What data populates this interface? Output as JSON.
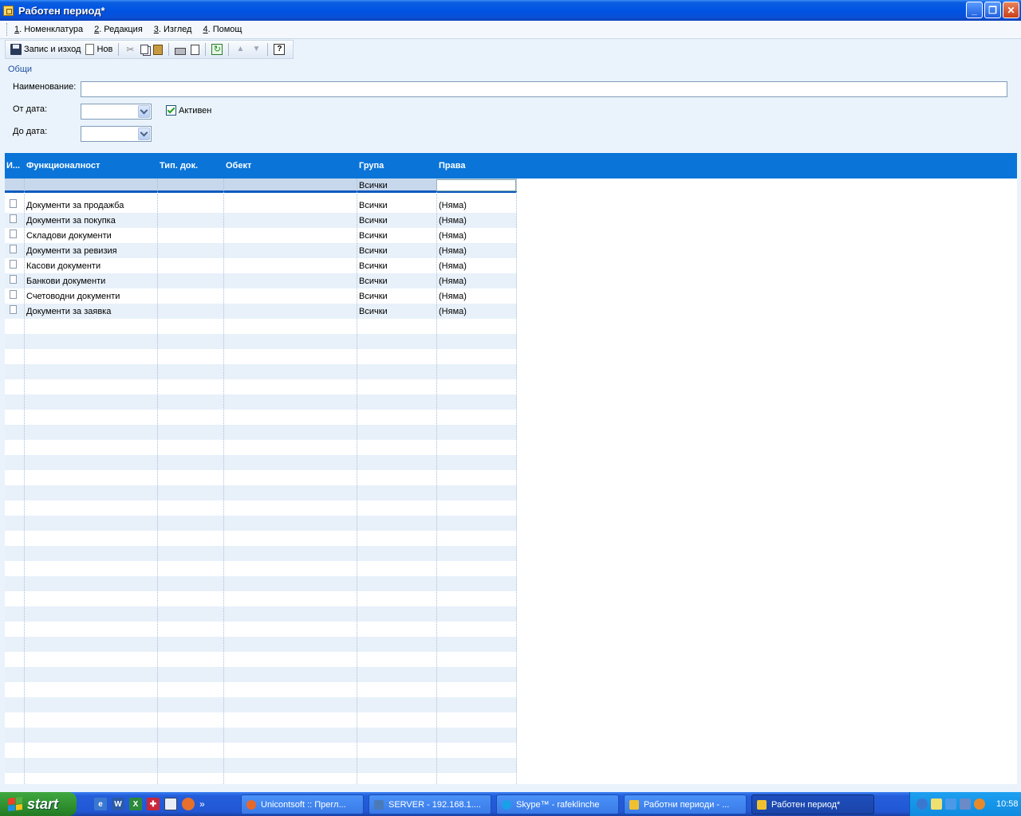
{
  "window": {
    "title": "Работен период*"
  },
  "menu": [
    {
      "key": "1",
      "label": ". Номенклатура"
    },
    {
      "key": "2",
      "label": ". Редакция"
    },
    {
      "key": "3",
      "label": ". Изглед"
    },
    {
      "key": "4",
      "label": ". Помощ"
    }
  ],
  "toolbar": {
    "save_label": "Запис и изход",
    "new_label": "Нов"
  },
  "form": {
    "tab": "Общи",
    "name_label": "Наименование:",
    "name_value": "",
    "from_label": "От дата:",
    "from_value": "",
    "to_label": "До дата:",
    "to_value": "",
    "active_label": "Активен",
    "active_checked": true
  },
  "grid": {
    "columns": [
      "И...",
      "Функционалност",
      "Тип. док.",
      "Обект",
      "Група",
      "Права"
    ],
    "filter": {
      "group": "Всички",
      "rights": ""
    },
    "rows": [
      {
        "func": "Документи за продажба",
        "group": "Всички",
        "rights": "(Няма)"
      },
      {
        "func": "Документи за покупка",
        "group": "Всички",
        "rights": "(Няма)"
      },
      {
        "func": "Складови документи",
        "group": "Всички",
        "rights": "(Няма)"
      },
      {
        "func": "Документи за ревизия",
        "group": "Всички",
        "rights": "(Няма)"
      },
      {
        "func": "Касови документи",
        "group": "Всички",
        "rights": "(Няма)"
      },
      {
        "func": "Банкови документи",
        "group": "Всички",
        "rights": "(Няма)"
      },
      {
        "func": "Счетоводни документи",
        "group": "Всички",
        "rights": "(Няма)"
      },
      {
        "func": "Документи за заявка",
        "group": "Всички",
        "rights": "(Няма)"
      }
    ]
  },
  "taskbar": {
    "start": "start",
    "tasks": [
      {
        "label": "Unicontsoft :: Прегл...",
        "icon": "firefox-icon",
        "color": "#e8682a"
      },
      {
        "label": "SERVER - 192.168.1....",
        "icon": "remote-desktop-icon",
        "color": "#4a7ab8"
      },
      {
        "label": "Skype™ - rafeklinche",
        "icon": "skype-icon",
        "color": "#1aa0e8"
      },
      {
        "label": "Работни периоди - ...",
        "icon": "app-icon",
        "color": "#f0c030"
      },
      {
        "label": "Работен период*",
        "icon": "app-icon",
        "color": "#f0c030"
      }
    ],
    "clock": "10:58"
  },
  "colors": {
    "header": "#0a74d8",
    "title": "#0054e3",
    "accent": "#2050a0"
  }
}
